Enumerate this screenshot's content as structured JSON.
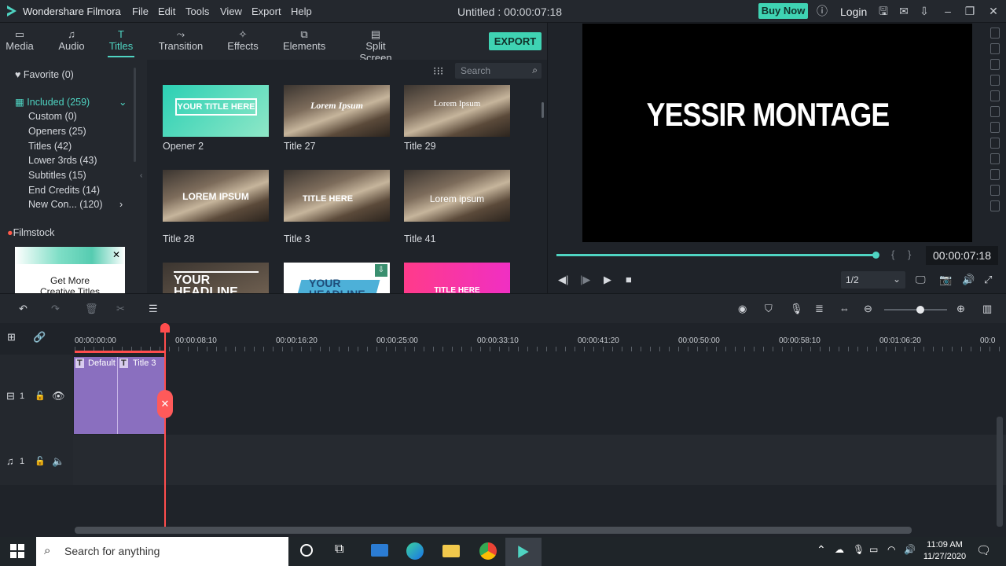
{
  "app": {
    "name": "Wondershare Filmora",
    "window_title": "Untitled : 00:00:07:18"
  },
  "menu": [
    "File",
    "Edit",
    "Tools",
    "View",
    "Export",
    "Help"
  ],
  "header": {
    "buy_now": "Buy Now",
    "login": "Login"
  },
  "tabs": [
    {
      "label": "Media",
      "icon": "folder-icon"
    },
    {
      "label": "Audio",
      "icon": "music-note-icon"
    },
    {
      "label": "Titles",
      "icon": "text-icon",
      "active": true
    },
    {
      "label": "Transition",
      "icon": "transition-icon"
    },
    {
      "label": "Effects",
      "icon": "effects-icon"
    },
    {
      "label": "Elements",
      "icon": "elements-icon"
    },
    {
      "label": "Split Screen",
      "icon": "split-screen-icon"
    }
  ],
  "export_label": "EXPORT",
  "sidebar": {
    "favorite": "Favorite (0)",
    "included": "Included (259)",
    "items": [
      "Custom (0)",
      "Openers (25)",
      "Titles (42)",
      "Lower 3rds (43)",
      "Subtitles (15)",
      "End Credits (14)",
      "New Con... (120)"
    ],
    "filmstock": "Filmstock",
    "ad_text_1": "Get More",
    "ad_text_2": "Creative Titles"
  },
  "search": {
    "placeholder": "Search"
  },
  "thumbs": [
    {
      "caption": "Opener 2",
      "overlay": "YOUR TITLE HERE"
    },
    {
      "caption": "Title 27",
      "overlay": "Lorem Ipsum"
    },
    {
      "caption": "Title 29",
      "overlay": "Lorem Ipsum"
    },
    {
      "caption": "Title 28",
      "overlay": "LOREM IPSUM"
    },
    {
      "caption": "Title 3",
      "overlay": "TITLE HERE"
    },
    {
      "caption": "Title 41",
      "overlay": "Lorem ipsum"
    },
    {
      "caption": "",
      "overlay": "YOUR HEADLINE"
    },
    {
      "caption": "",
      "overlay": "YOUR HEADLINE"
    },
    {
      "caption": "",
      "overlay": "TITLE HERE"
    }
  ],
  "preview": {
    "title_text": "YESSIR MONTAGE",
    "timecode": "00:00:07:18",
    "quality": "1/2"
  },
  "ruler": [
    "00:00:00:00",
    "00:00:08:10",
    "00:00:16:20",
    "00:00:25:00",
    "00:00:33:10",
    "00:00:41:20",
    "00:00:50:00",
    "00:00:58:10",
    "00:01:06:20",
    "00:0"
  ],
  "tracks": {
    "video_track": "1",
    "audio_track": "1",
    "clip_default": "Default",
    "clip_title": "Title 3"
  },
  "taskbar": {
    "search_placeholder": "Search for anything",
    "time": "11:09 AM",
    "date": "11/27/2020"
  },
  "colors": {
    "accent": "#4fd4c2",
    "clip": "#8a6fbf",
    "playhead": "#ff4d4d"
  }
}
